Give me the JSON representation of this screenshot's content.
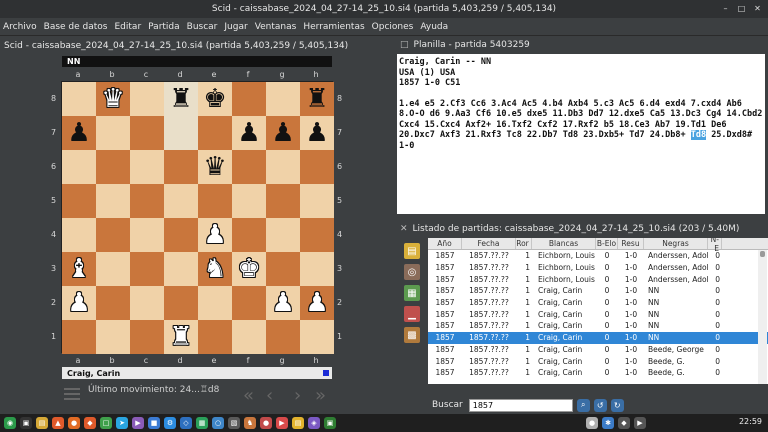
{
  "window": {
    "title": "Scid - caissabase_2024_04_27-14_25_10.si4 (partida 5,403,259 / 5,405,134)",
    "controls": [
      "minimize-icon",
      "maximize-icon",
      "close-icon"
    ]
  },
  "menu": [
    "Archivo",
    "Base de datos",
    "Editar",
    "Partida",
    "Buscar",
    "Jugar",
    "Ventanas",
    "Herramientas",
    "Opciones",
    "Ayuda"
  ],
  "board_panel": {
    "title": "Scid - caissabase_2024_04_27-14_25_10.si4 (partida 5,403,259 / 5,405,134)",
    "black_player": "NN",
    "white_player": "Craig, Carin",
    "files": [
      "a",
      "b",
      "c",
      "d",
      "e",
      "f",
      "g",
      "h"
    ],
    "ranks": [
      "8",
      "7",
      "6",
      "5",
      "4",
      "3",
      "2",
      "1"
    ],
    "last_move": "Último movimiento: 24...♖d8",
    "position": [
      [
        "",
        "wQ",
        "",
        "bR",
        "bK",
        "",
        "",
        "bR"
      ],
      [
        "bP",
        "",
        "",
        "",
        "",
        "bP",
        "bP",
        "bP"
      ],
      [
        "",
        "",
        "",
        "",
        "bQ",
        "",
        "",
        ""
      ],
      [
        "",
        "",
        "",
        "",
        "",
        "",
        "",
        ""
      ],
      [
        "",
        "",
        "",
        "",
        "wP",
        "",
        "",
        ""
      ],
      [
        "wB",
        "",
        "",
        "",
        "wN",
        "wK",
        "",
        ""
      ],
      [
        "wP",
        "",
        "",
        "",
        "",
        "",
        "wP",
        "wP"
      ],
      [
        "",
        "",
        "",
        "wR",
        "",
        "",
        "",
        ""
      ]
    ],
    "highlight": [
      "d8",
      "d7"
    ]
  },
  "notation_panel": {
    "title": "Planilla - partida 5403259",
    "header_line1": "Craig, Carin  --  NN",
    "header_line2": "USA (1)  USA",
    "header_line3": "1857  1-0  C51",
    "moves_before": "1.e4 e5 2.Cf3 Cc6 3.Ac4 Ac5 4.b4 Axb4 5.c3 Ac5 6.d4 exd4 7.cxd4 Ab6 8.O-O d6 9.Aa3 Cf6 10.e5 dxe5 11.Db3 Dd7 12.dxe5 Ca5 13.Dc3 Cg4 14.Cbd2 Cxc4 15.Cxc4 Axf2+ 16.Txf2 Cxf2 17.Rxf2 b5 18.Ce3 Ab7 19.Td1 De6 20.Dxc7 Axf3 21.Rxf3 Tc8 22.Db7 Td8 23.Dxb5+ Td7 24.Db8+",
    "moves_selected": "Td8",
    "moves_after": "25.Dxd8# 1-0"
  },
  "games_panel": {
    "title": "Listado de partidas: caissabase_2024_04_27-14_25_10.si4 (203 / 5.40M)",
    "columns": [
      "Año",
      "Fecha",
      "Ror",
      "Blancas",
      "B-Elo",
      "Resu",
      "Negras",
      "N-E"
    ],
    "rows": [
      [
        "1857",
        "1857.??.??",
        "1",
        "Eichborn, Louis",
        "0",
        "1-0",
        "Anderssen, Adolf",
        "0"
      ],
      [
        "1857",
        "1857.??.??",
        "1",
        "Eichborn, Louis",
        "0",
        "1-0",
        "Anderssen, Adolf",
        "0"
      ],
      [
        "1857",
        "1857.??.??",
        "1",
        "Eichborn, Louis",
        "0",
        "1-0",
        "Anderssen, Adolf",
        "0"
      ],
      [
        "1857",
        "1857.??.??",
        "1",
        "Craig, Carin",
        "0",
        "1-0",
        "NN",
        "0"
      ],
      [
        "1857",
        "1857.??.??",
        "1",
        "Craig, Carin",
        "0",
        "1-0",
        "NN",
        "0"
      ],
      [
        "1857",
        "1857.??.??",
        "1",
        "Craig, Carin",
        "0",
        "1-0",
        "NN",
        "0"
      ],
      [
        "1857",
        "1857.??.??",
        "1",
        "Craig, Carin",
        "0",
        "1-0",
        "NN",
        "0"
      ],
      [
        "1857",
        "1857.??.??",
        "1",
        "Craig, Carin",
        "0",
        "1-0",
        "NN",
        "0"
      ],
      [
        "1857",
        "1857.??.??",
        "1",
        "Craig, Carin",
        "0",
        "1-0",
        "Beede, George",
        "0"
      ],
      [
        "1857",
        "1857.??.??",
        "1",
        "Craig, Carin",
        "0",
        "1-0",
        "Beede, G.",
        "0"
      ],
      [
        "1857",
        "1857.??.??",
        "1",
        "Craig, Carin",
        "0",
        "1-0",
        "Beede, G.",
        "0"
      ]
    ],
    "selected_row": 7,
    "search_label": "Buscar",
    "search_value": "1857"
  },
  "taskbar": {
    "time": "22:59"
  },
  "colors": {
    "light_square": "#f0d2a8",
    "dark_square": "#c9763c",
    "selection": "#2f86d6"
  }
}
